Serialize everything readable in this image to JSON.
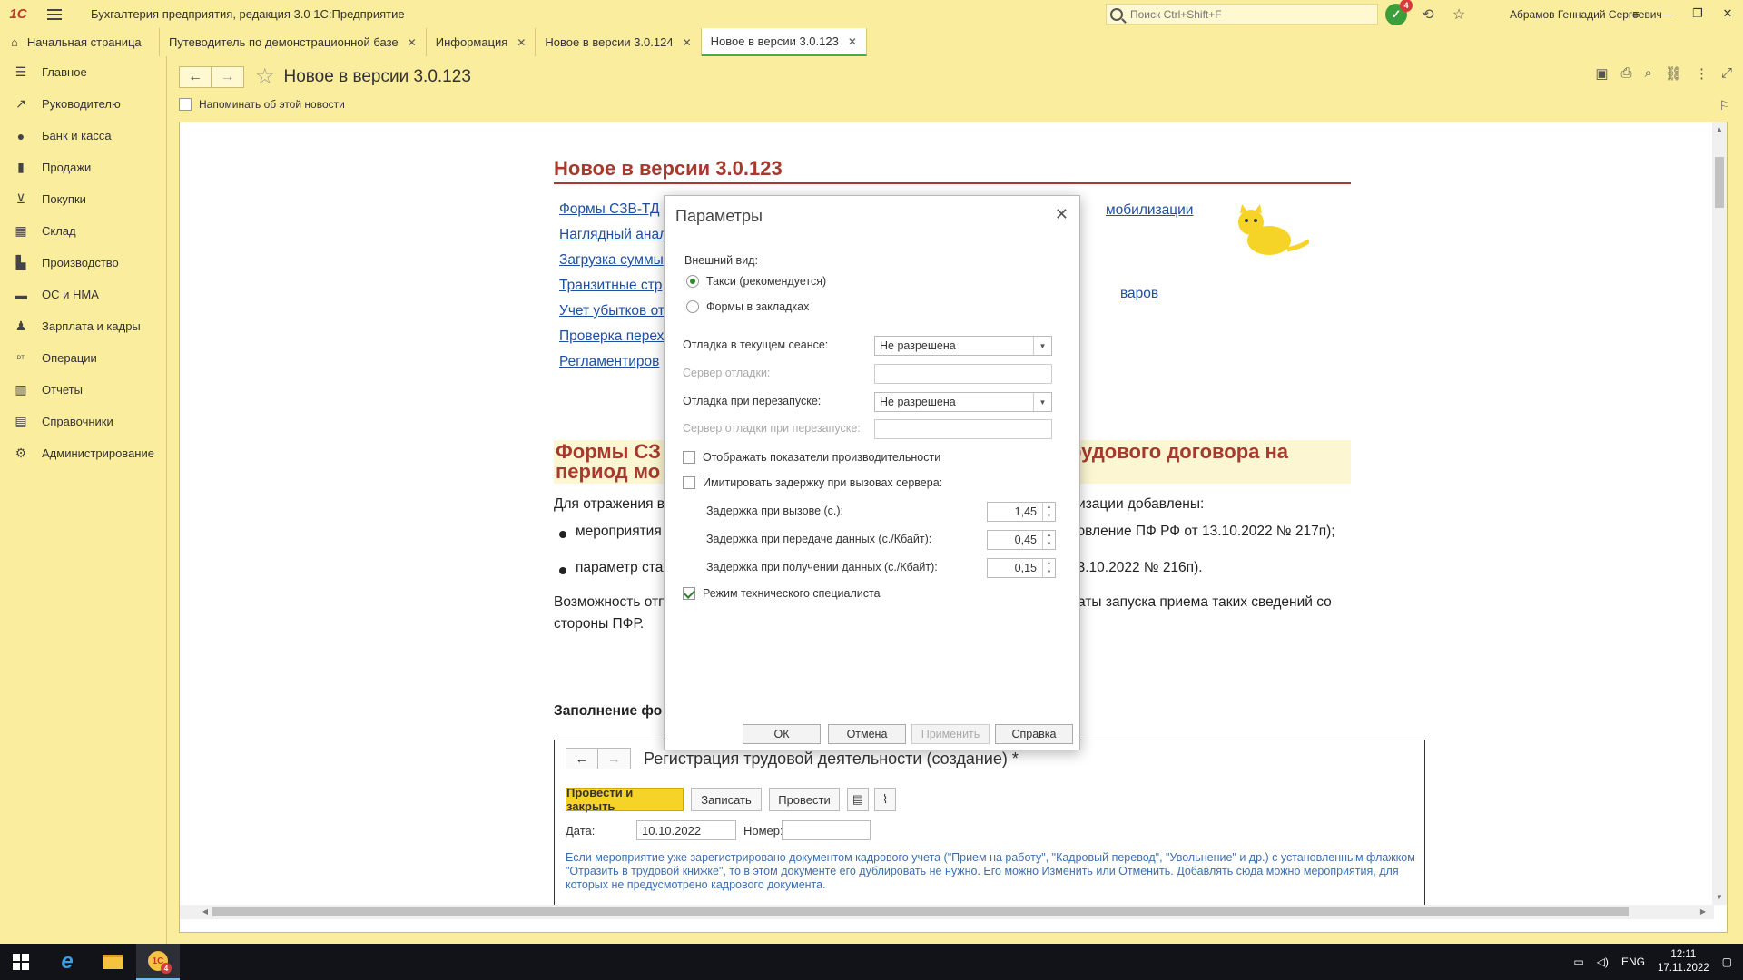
{
  "app": {
    "title": "Бухгалтерия предприятия, редакция 3.0 1С:Предприятие",
    "logo": "1С",
    "search_placeholder": "Поиск Ctrl+Shift+F",
    "notifications_count": "4",
    "user": "Абрамов Геннадий Сергеевич"
  },
  "tabs": {
    "home": "Начальная страница",
    "items": [
      {
        "label": "Путеводитель по демонстрационной базе"
      },
      {
        "label": "Информация"
      },
      {
        "label": "Новое в версии 3.0.124"
      },
      {
        "label": "Новое в версии 3.0.123"
      }
    ]
  },
  "sidebar": {
    "items": [
      {
        "label": "Главное",
        "icon": "menu-icon"
      },
      {
        "label": "Руководителю",
        "icon": "trend-icon"
      },
      {
        "label": "Банк и касса",
        "icon": "coin-icon"
      },
      {
        "label": "Продажи",
        "icon": "bag-icon"
      },
      {
        "label": "Покупки",
        "icon": "cart-icon"
      },
      {
        "label": "Склад",
        "icon": "warehouse-icon"
      },
      {
        "label": "Производство",
        "icon": "factory-icon"
      },
      {
        "label": "ОС и НМА",
        "icon": "truck-icon"
      },
      {
        "label": "Зарплата и кадры",
        "icon": "person-icon"
      },
      {
        "label": "Операции",
        "icon": "dtkt-icon"
      },
      {
        "label": "Отчеты",
        "icon": "chart-icon"
      },
      {
        "label": "Справочники",
        "icon": "book-icon"
      },
      {
        "label": "Администрирование",
        "icon": "gear-icon"
      }
    ]
  },
  "document": {
    "title": "Новое в версии 3.0.123",
    "remind_label": "Напоминать об этой новости"
  },
  "news": {
    "heading": "Новое в версии 3.0.123",
    "links": [
      "Формы СЗВ-ТД",
      "Наглядный анал",
      "Загрузка суммы",
      "Транзитные стр",
      "Учет убытков от",
      "Проверка перех",
      "Регламентиров"
    ],
    "link_right_1": "мобилизации",
    "link_right_2": "варов",
    "section_heading_left_1": "Формы СЗ",
    "section_heading_left_2": "период мо",
    "section_heading_right": "рудового договора на",
    "para1_left": "Для отражения в",
    "para1_right": "лизации добавлены:",
    "bullet1_left": "мероприятия П",
    "bullet1_right": "новление ПФ РФ от 13.10.2022 № 217п);",
    "bullet2_left": "параметр стаж",
    "bullet2_right": "13.10.2022 № 216п).",
    "para2_left_1": "Возможность отп",
    "para2_right_1": "даты запуска приема таких сведений со",
    "para2_left_2": "стороны ПФР.",
    "subhead": "Заполнение фо"
  },
  "embed": {
    "title": "Регистрация трудовой деятельности (создание) *",
    "btn_post_close": "Провести и закрыть",
    "btn_save": "Записать",
    "btn_post": "Провести",
    "date_label": "Дата:",
    "date_value": "10.10.2022",
    "number_label": "Номер:",
    "note": "Если мероприятие уже зарегистрировано документом кадрового учета (\"Прием на работу\", \"Кадровый перевод\", \"Увольнение\" и др.) с установленным флажком \"Отразить в трудовой книжке\", то в этом документе его дублировать не нужно. Его можно Изменить или Отменить. Добавлять сюда можно мероприятия, для которых не предусмотрено кадрового документа."
  },
  "dialog": {
    "title": "Параметры",
    "appearance_label": "Внешний вид:",
    "radio_taxi": "Такси (рекомендуется)",
    "radio_tabs": "Формы в закладках",
    "debug_session_label": "Отладка в текущем сеансе:",
    "debug_session_value": "Не разрешена",
    "debug_server_label": "Сервер отладки:",
    "debug_restart_label": "Отладка при перезапуске:",
    "debug_restart_value": "Не разрешена",
    "debug_server_restart_label": "Сервер отладки при перезапуске:",
    "show_perf_label": "Отображать показатели производительности",
    "simulate_delay_label": "Имитировать задержку при вызовах сервера:",
    "call_delay_label": "Задержка при вызове (с.):",
    "call_delay_value": "1,45",
    "send_delay_label": "Задержка при передаче данных (с./Кбайт):",
    "send_delay_value": "0,45",
    "recv_delay_label": "Задержка при получении данных (с./Кбайт):",
    "recv_delay_value": "0,15",
    "tech_mode_label": "Режим технического специалиста",
    "btn_ok": "ОК",
    "btn_cancel": "Отмена",
    "btn_apply": "Применить",
    "btn_help": "Справка"
  },
  "taskbar": {
    "lang": "ENG",
    "time": "12:11",
    "date": "17.11.2022",
    "app_badge": "4"
  }
}
